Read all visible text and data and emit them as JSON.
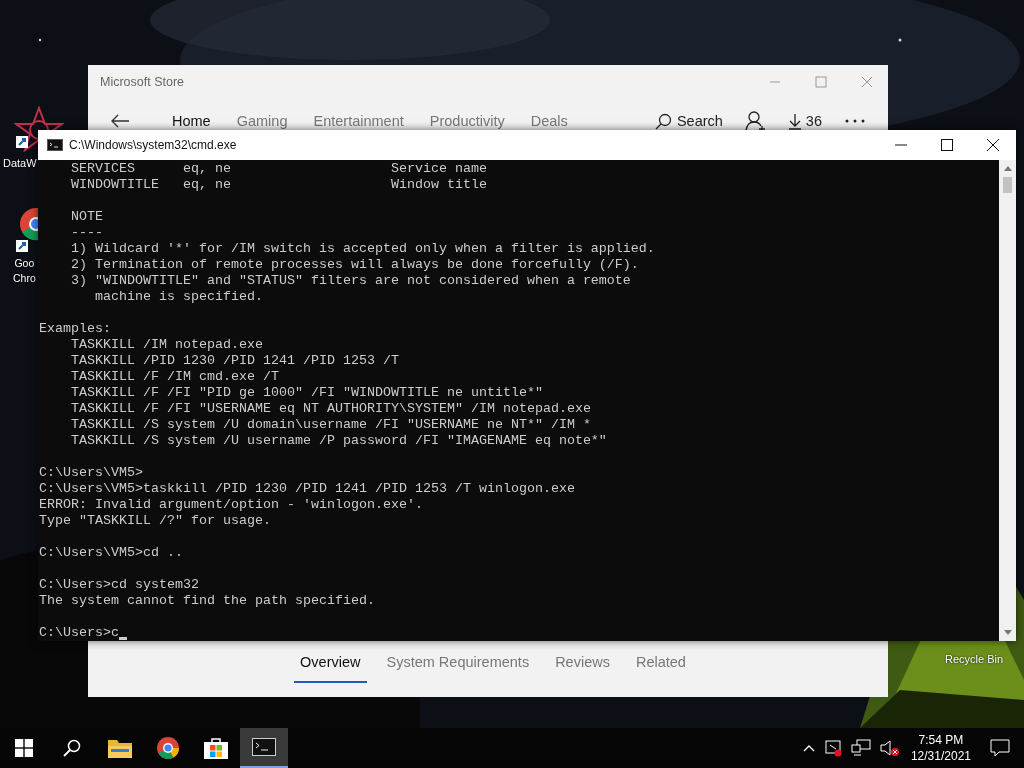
{
  "desktop": {
    "icons": [
      {
        "kind": "rose",
        "label": [
          "DataW"
        ]
      },
      {
        "kind": "chrome",
        "label": [
          "Goo",
          "Chro"
        ]
      },
      {
        "kind": "recycle",
        "label": [
          "Recycle Bin"
        ]
      }
    ]
  },
  "store": {
    "title": "Microsoft Store",
    "nav": [
      {
        "label": "Home",
        "selected": true
      },
      {
        "label": "Gaming",
        "selected": false
      },
      {
        "label": "Entertainment",
        "selected": false
      },
      {
        "label": "Productivity",
        "selected": false
      },
      {
        "label": "Deals",
        "selected": false
      }
    ],
    "search": "Search",
    "downloads": "36",
    "tabs": [
      {
        "label": "Overview",
        "selected": true
      },
      {
        "label": "System Requirements",
        "selected": false
      },
      {
        "label": "Reviews",
        "selected": false
      },
      {
        "label": "Related",
        "selected": false
      }
    ]
  },
  "cmd": {
    "title": "C:\\Windows\\system32\\cmd.exe",
    "output": [
      [
        "    SERVICES      eq, ne                    Service name",
        "    WINDOWTITLE   eq, ne                    Window title"
      ],
      [
        "    NOTE",
        "    ----",
        "    1) Wildcard '*' for /IM switch is accepted only when a filter is applied.",
        "    2) Termination of remote processes will always be done forcefully (/F).",
        "    3) \"WINDOWTITLE\" and \"STATUS\" filters are not considered when a remote",
        "       machine is specified."
      ],
      [
        "Examples:",
        "    TASKKILL /IM notepad.exe",
        "    TASKKILL /PID 1230 /PID 1241 /PID 1253 /T",
        "    TASKKILL /F /IM cmd.exe /T",
        "    TASKKILL /F /FI \"PID ge 1000\" /FI \"WINDOWTITLE ne untitle*\"",
        "    TASKKILL /F /FI \"USERNAME eq NT AUTHORITY\\SYSTEM\" /IM notepad.exe",
        "    TASKKILL /S system /U domain\\username /FI \"USERNAME ne NT*\" /IM *",
        "    TASKKILL /S system /U username /P password /FI \"IMAGENAME eq note*\""
      ],
      [
        "C:\\Users\\VM5>",
        "C:\\Users\\VM5>taskkill /PID 1230 /PID 1241 /PID 1253 /T winlogon.exe",
        "ERROR: Invalid argument/option - 'winlogon.exe'.",
        "Type \"TASKKILL /?\" for usage."
      ],
      [
        "C:\\Users\\VM5>cd .."
      ],
      [
        "C:\\Users>cd system32",
        "The system cannot find the path specified."
      ],
      [
        "C:\\Users>c"
      ]
    ]
  },
  "taskbar": {
    "apps": [
      {
        "kind": "start",
        "selected": false
      },
      {
        "kind": "search",
        "selected": false
      },
      {
        "kind": "explorer",
        "selected": false
      },
      {
        "kind": "chrome",
        "selected": false
      },
      {
        "kind": "store",
        "selected": false
      },
      {
        "kind": "terminal",
        "selected": true
      }
    ],
    "time": "7:54 PM",
    "date": "12/31/2021"
  }
}
